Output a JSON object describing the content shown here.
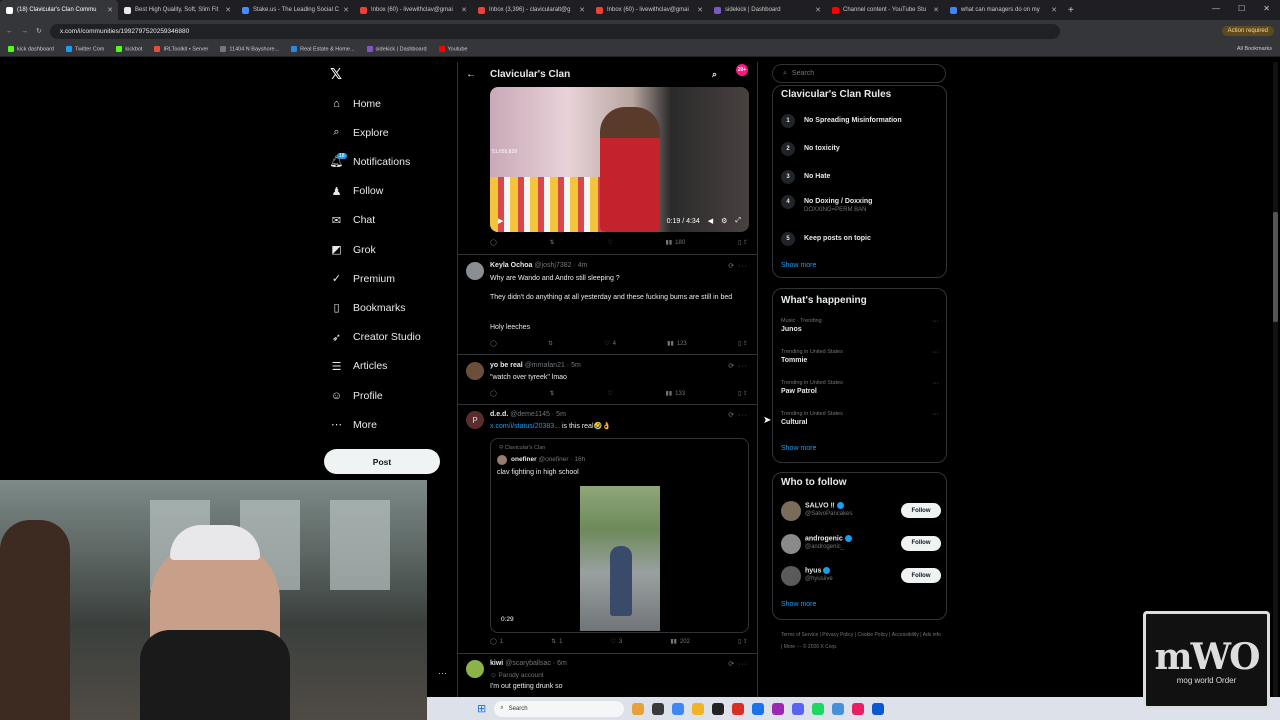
{
  "browser": {
    "tabs": [
      {
        "title": "(18) Clavicular's Clan Commu",
        "color": "#ffffff",
        "active": true
      },
      {
        "title": "Best High Quality, Soft, Slim Fit",
        "color": "#e9e9e9"
      },
      {
        "title": "Stake.us - The Leading Social C",
        "color": "#4b8bf5"
      },
      {
        "title": "Inbox (60) - livewithclav@gmai",
        "color": "#ea4335"
      },
      {
        "title": "Inbox (3,396) - clavicularalt@g",
        "color": "#ea4335"
      },
      {
        "title": "Inbox (60) - livewithclav@gmai",
        "color": "#ea4335"
      },
      {
        "title": "sidekick | Dashboard",
        "color": "#7e57c2"
      },
      {
        "title": "Channel content - YouTube Stu",
        "color": "#ff0000"
      },
      {
        "title": "what can managers do on my",
        "color": "#4285f4"
      }
    ],
    "url": "x.com/i/communities/1992797520259346880",
    "action_required": "Action required",
    "bookmarks": [
      {
        "label": "kick dashboard",
        "color": "#53fc18"
      },
      {
        "label": "Twitter Com",
        "color": "#1d9bf0"
      },
      {
        "label": "kickbot",
        "color": "#53fc18"
      },
      {
        "label": "IRLToolkit • Server",
        "color": "#e84c3d"
      },
      {
        "label": "11404 N Bayshore...",
        "color": "#777777"
      },
      {
        "label": "Real Estate & Home...",
        "color": "#2e86de"
      },
      {
        "label": "sidekick | Dashboard",
        "color": "#7e57c2"
      },
      {
        "label": "Youtube",
        "color": "#ff0000"
      }
    ],
    "all_bookmarks": "All Bookmarks"
  },
  "nav": {
    "items": [
      {
        "label": "Home",
        "icon": "home-icon"
      },
      {
        "label": "Explore",
        "icon": "search-icon"
      },
      {
        "label": "Notifications",
        "icon": "bell-icon"
      },
      {
        "label": "Follow",
        "icon": "follow-icon"
      },
      {
        "label": "Chat",
        "icon": "mail-icon"
      },
      {
        "label": "Grok",
        "icon": "grok-icon"
      },
      {
        "label": "Premium",
        "icon": "premium-icon"
      },
      {
        "label": "Bookmarks",
        "icon": "bookmark-icon"
      },
      {
        "label": "Creator Studio",
        "icon": "rocket-icon"
      },
      {
        "label": "Articles",
        "icon": "article-icon"
      },
      {
        "label": "Profile",
        "icon": "profile-icon"
      },
      {
        "label": "More",
        "icon": "more-icon"
      }
    ],
    "notif_badge": "18",
    "post_label": "Post"
  },
  "feed": {
    "title": "Clavicular's Clan",
    "header_badge": "20+",
    "video1": {
      "views": "51,659,829",
      "time": "0:19 / 4:34"
    },
    "actions1": {
      "replies": "",
      "reposts": "",
      "likes": "",
      "views": "180"
    },
    "tweets": [
      {
        "name": "Keyla Ochoa",
        "handle": "@joshj7382 · 4m",
        "lines": [
          "Why are Wando and Andro still sleeping ?",
          "They didn't do anything at all yesterday and these fucking bums are still in bed",
          "Holy leeches"
        ],
        "likes": "4",
        "views": "123"
      },
      {
        "name": "yo be real",
        "handle": "@mmafan21 · 5m",
        "lines": [
          "\"watch over tyreek\" lmao"
        ],
        "views": "133"
      },
      {
        "name": "d.e.d.",
        "handle": "@deme1145 · 5m",
        "link": "x.com/i/status/20383...",
        "text_after": " is this real🤣👌",
        "quote": {
          "community": "Clavicular's Clan",
          "name": "onefiner",
          "handle": "@onefiner · 16h",
          "text": "clav fighting in high school",
          "duration": "0:29"
        },
        "replies": "1",
        "reposts": "1",
        "likes": "3",
        "views": "202"
      },
      {
        "name": "kiwi",
        "handle": "@scaryballsac · 6m",
        "parody": "Parody account",
        "lines": [
          "I'm out getting drunk so"
        ]
      }
    ]
  },
  "right": {
    "search_placeholder": "Search",
    "rules_title": "Clavicular's Clan Rules",
    "rules": [
      {
        "n": "1",
        "text": "No Spreading Misinformation",
        "sub": ""
      },
      {
        "n": "2",
        "text": "No toxicity",
        "sub": ""
      },
      {
        "n": "3",
        "text": "No Hate",
        "sub": ""
      },
      {
        "n": "4",
        "text": "No Doxing / Doxxing",
        "sub": "DOXXING=PERM BAN"
      },
      {
        "n": "5",
        "text": "Keep posts on topic",
        "sub": ""
      }
    ],
    "show_more": "Show more",
    "happening_title": "What's happening",
    "trends": [
      {
        "cat": "Music · Trending",
        "name": "Junos"
      },
      {
        "cat": "Trending in United States",
        "name": "Tommie"
      },
      {
        "cat": "Trending in United States",
        "name": "Paw Patrol"
      },
      {
        "cat": "Trending in United States",
        "name": "Cultural"
      }
    ],
    "follow_title": "Who to follow",
    "follows": [
      {
        "name": "SALVO ‼",
        "handle": "@SalvoPancakes",
        "color": "#7a6b5a"
      },
      {
        "name": "androgenic",
        "handle": "@androgenic_",
        "color": "#8a8a8a"
      },
      {
        "name": "hyus",
        "handle": "@hyusiive",
        "color": "#5a5a5a"
      }
    ],
    "follow_btn": "Follow",
    "footer": "Terms of Service  |  Privacy Policy  |  Cookie Policy  |  Accessibility  |  Ads info  |  More ···  © 2026 X Corp."
  },
  "taskbar": {
    "search": "Search"
  },
  "overlay": {
    "logo_big": "mWO",
    "logo_small": "mog world Order"
  }
}
